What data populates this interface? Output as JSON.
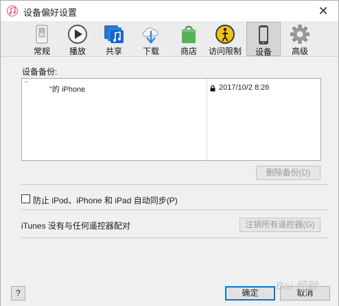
{
  "window": {
    "title": "设备偏好设置",
    "close_glyph": "✕"
  },
  "toolbar": {
    "items": [
      {
        "label": "常规",
        "icon": "general-switch-icon"
      },
      {
        "label": "播放",
        "icon": "play-icon"
      },
      {
        "label": "共享",
        "icon": "music-sharing-icon"
      },
      {
        "label": "下载",
        "icon": "cloud-download-icon"
      },
      {
        "label": "商店",
        "icon": "shopping-bag-icon"
      },
      {
        "label": "访问限制",
        "icon": "parental-controls-icon"
      },
      {
        "label": "设备",
        "icon": "device-phone-icon"
      },
      {
        "label": "高级",
        "icon": "gear-icon"
      }
    ],
    "selected_index": 6,
    "colors": {
      "share_blue": "#1f6fd1",
      "store_green": "#4caf50",
      "restrict_yellow": "#e8b400"
    }
  },
  "backups": {
    "section_label": "设备备份:",
    "rows": [
      {
        "name": "\"的 iPhone",
        "date": "2017/10/2 8:26",
        "tick": "‵‵"
      }
    ],
    "delete_button": "删除备份(D)"
  },
  "sync": {
    "checkbox_label": "防止 iPod、iPhone 和 iPad 自动同步(P)",
    "checked": false
  },
  "remotes": {
    "status": "iTunes 没有与任何遥控器配对",
    "unpair_button": "注销所有遥控器(G)"
  },
  "footer": {
    "help_button": "?",
    "ok_button": "确定",
    "cancel_button": "取消",
    "watermark": "Bai 经验"
  }
}
